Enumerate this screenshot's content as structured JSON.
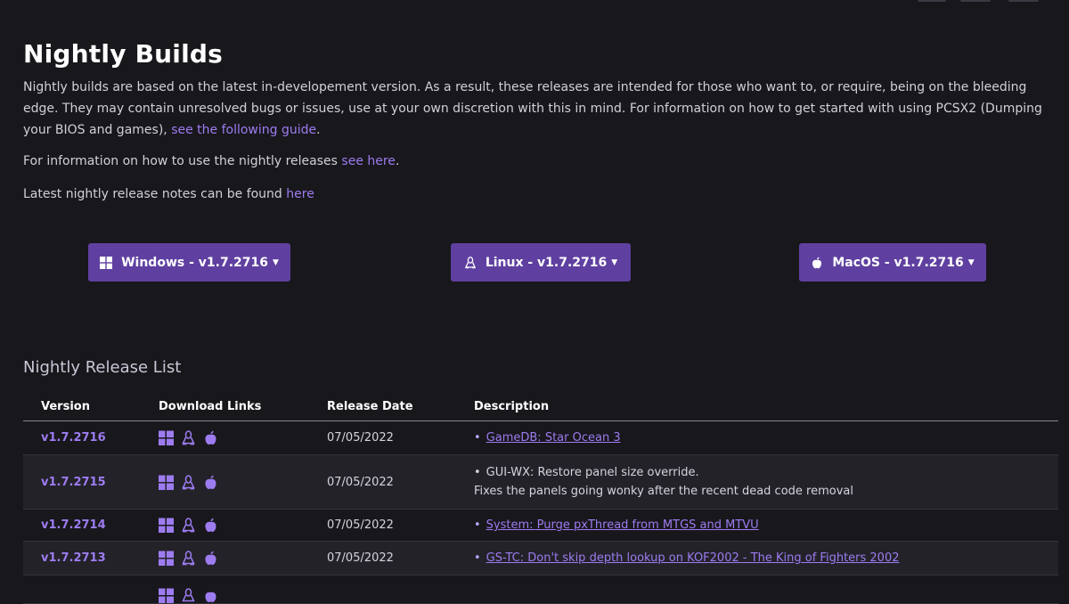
{
  "page": {
    "title": "Nightly Builds",
    "intro_text": "Nightly builds are based on the latest in-developement version. As a result, these releases are intended for those who want to, or require, being on the bleeding edge. They may contain unresolved bugs or issues, use at your own discretion with this in mind. For information on how to get started with using PCSX2 (Dumping your BIOS and games), ",
    "intro_link": "see the following guide",
    "intro_end": ".",
    "usage_text": "For information on how to use the nightly releases ",
    "usage_link": "see here",
    "usage_end": ".",
    "notes_text": "Latest nightly release notes can be found ",
    "notes_link": "here"
  },
  "downloads": [
    {
      "os": "Windows",
      "label": "Windows - v1.7.2716",
      "icon": "windows-icon"
    },
    {
      "os": "Linux",
      "label": "Linux - v1.7.2716",
      "icon": "linux-icon"
    },
    {
      "os": "MacOS",
      "label": "MacOS - v1.7.2716",
      "icon": "apple-icon"
    }
  ],
  "release_list": {
    "title": "Nightly Release List",
    "columns": [
      "Version",
      "Download Links",
      "Release Date",
      "Description"
    ],
    "rows": [
      {
        "version": "v1.7.2716",
        "date": "07/05/2022",
        "desc": "GameDB: Star Ocean 3",
        "desc_extra": ""
      },
      {
        "version": "v1.7.2715",
        "date": "07/05/2022",
        "desc": "GUI-WX: Restore panel size override.",
        "desc_extra": "Fixes the panels going wonky after the recent dead code removal"
      },
      {
        "version": "v1.7.2714",
        "date": "07/05/2022",
        "desc": "System: Purge pxThread from MTGS and MTVU",
        "desc_extra": ""
      },
      {
        "version": "v1.7.2713",
        "date": "07/05/2022",
        "desc": "GS-TC: Don't skip depth lookup on KOF2002 - The King of Fighters 2002",
        "desc_extra": ""
      }
    ]
  },
  "colors": {
    "background": "#18171c",
    "accent": "#5f40a0",
    "link": "#9d7cf0"
  }
}
